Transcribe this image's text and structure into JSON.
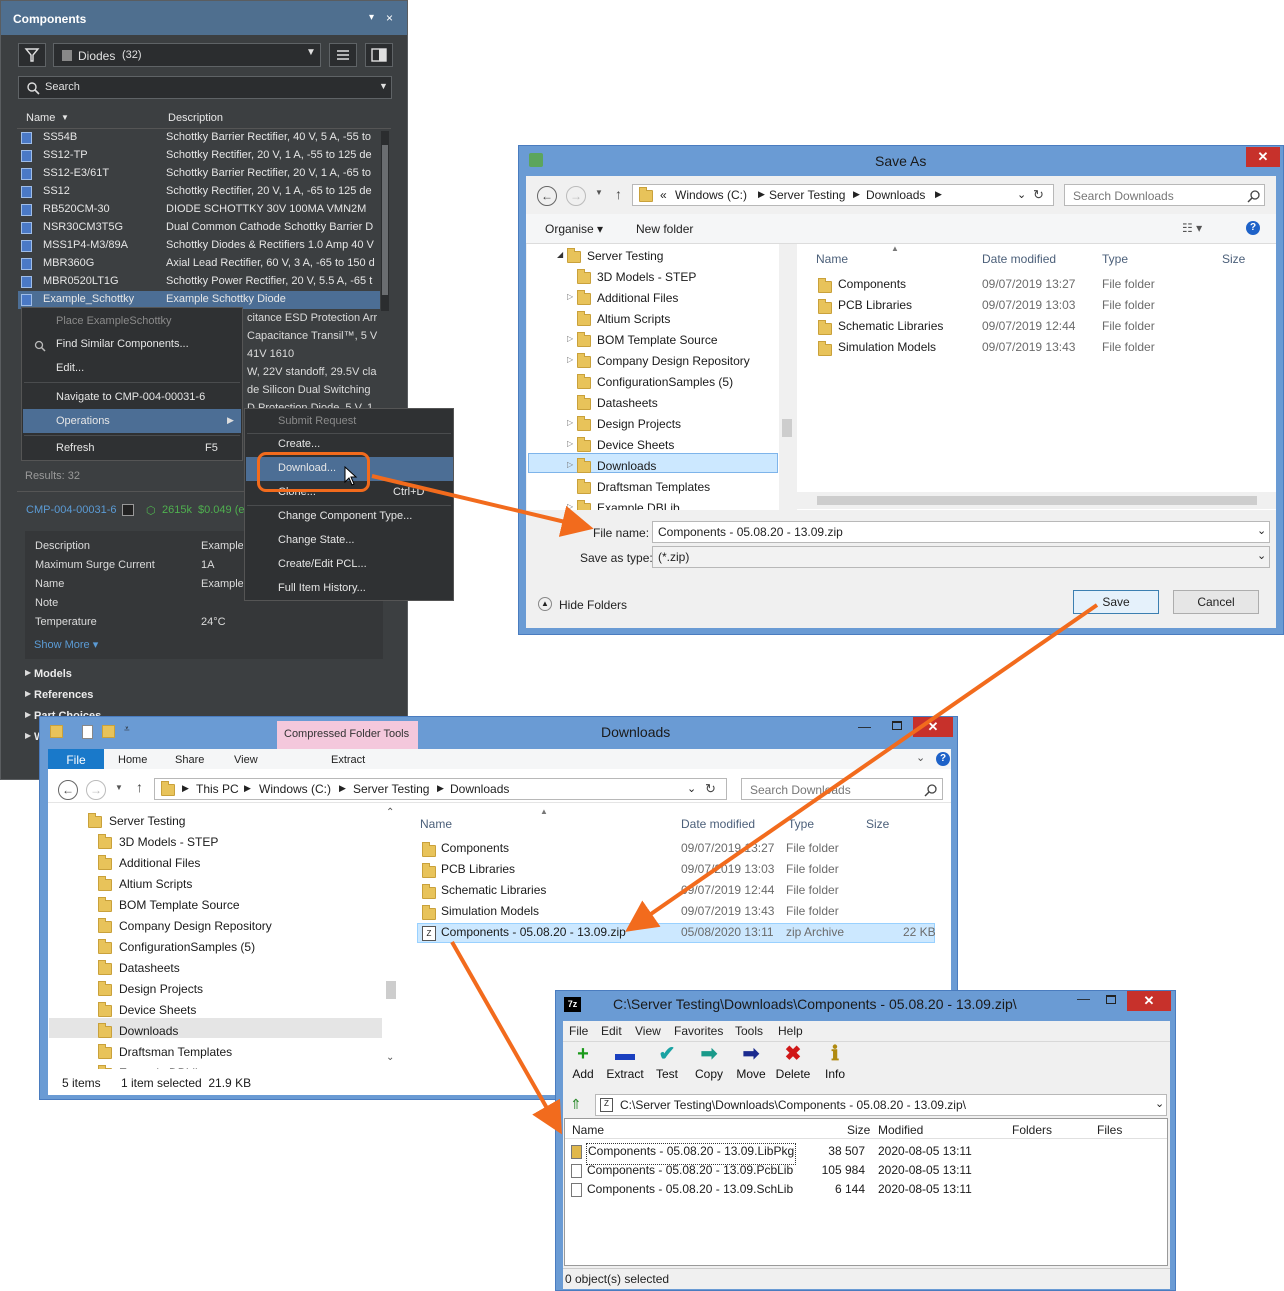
{
  "components_panel": {
    "title": "Components",
    "pin_glyph": "▾",
    "close_glyph": "×",
    "category": "Diodes",
    "count": "(32)",
    "search_placeholder": "Search",
    "columns": {
      "name": "Name",
      "description": "Description"
    },
    "rows": [
      {
        "name": "SS54B",
        "desc": "Schottky Barrier Rectifier, 40 V, 5 A, -55 to"
      },
      {
        "name": "SS12-TP",
        "desc": "Schottky Rectifier, 20 V, 1 A, -55 to 125 de"
      },
      {
        "name": "SS12-E3/61T",
        "desc": "Schottky Barrier Rectifier, 20 V, 1 A, -65 to"
      },
      {
        "name": "SS12",
        "desc": "Schottky Rectifier, 20 V, 1 A, -65 to 125 de"
      },
      {
        "name": "RB520CM-30",
        "desc": "DIODE SCHOTTKY 30V 100MA VMN2M"
      },
      {
        "name": "NSR30CM3T5G",
        "desc": "Dual Common Cathode Schottky Barrier D"
      },
      {
        "name": "MSS1P4-M3/89A",
        "desc": "Schottky Diodes & Rectifiers 1.0 Amp 40 V"
      },
      {
        "name": "MBR360G",
        "desc": "Axial Lead Rectifier, 60 V, 3 A, -65 to 150 d"
      },
      {
        "name": "MBR0520LT1G",
        "desc": "Schottky Power Rectifier, 20 V, 5.5 A, -65 t"
      },
      {
        "name": "Example_Schottky",
        "desc": "Example Schottky Diode"
      }
    ],
    "partial_rows": [
      "citance ESD Protection Arr",
      "Capacitance Transil™, 5 V",
      "41V 1610",
      "W, 22V standoff, 29.5V cla",
      "de Silicon Dual Switching",
      "D Protection Diode, 5 V, 1"
    ],
    "results": "Results: 32",
    "selected_id": "CMP-004-00031-6",
    "stock": "2615k",
    "price": "$0.049 (e",
    "properties": [
      {
        "label": "Description",
        "value": "Example"
      },
      {
        "label": "Maximum Surge Current",
        "value": "1A"
      },
      {
        "label": "Name",
        "value": "Example"
      },
      {
        "label": "Note",
        "value": ""
      },
      {
        "label": "Temperature",
        "value": "24°C"
      }
    ],
    "show_more": "Show More ▾",
    "sections": [
      "Models",
      "References",
      "Part Choices",
      "W"
    ]
  },
  "context_menu": {
    "place": "Place ExampleSchottky",
    "find_similar": "Find Similar Components...",
    "edit": "Edit...",
    "navigate": "Navigate to CMP-004-00031-6",
    "operations": "Operations",
    "refresh": "Refresh",
    "refresh_key": "F5"
  },
  "operations_menu": {
    "submit": "Submit Request",
    "create": "Create...",
    "download": "Download...",
    "clone": "Clone...",
    "clone_key": "Ctrl+D",
    "change_type": "Change Component Type...",
    "change_state": "Change State...",
    "pcl": "Create/Edit PCL...",
    "history": "Full Item History..."
  },
  "save_as": {
    "title": "Save As",
    "crumbs": [
      "«",
      "Windows (C:)",
      "Server Testing",
      "Downloads"
    ],
    "search_placeholder": "Search Downloads",
    "organise": "Organise ▾",
    "new_folder": "New folder",
    "tree": [
      "Server Testing",
      "3D Models - STEP",
      "Additional Files",
      "Altium Scripts",
      "BOM Template Source",
      "Company Design Repository",
      "ConfigurationSamples (5)",
      "Datasheets",
      "Design Projects",
      "Device Sheets",
      "Downloads",
      "Draftsman Templates",
      "Example DBLib"
    ],
    "columns": {
      "name": "Name",
      "date": "Date modified",
      "type": "Type",
      "size": "Size"
    },
    "files": [
      {
        "name": "Components",
        "date": "09/07/2019 13:27",
        "type": "File folder"
      },
      {
        "name": "PCB Libraries",
        "date": "09/07/2019 13:03",
        "type": "File folder"
      },
      {
        "name": "Schematic Libraries",
        "date": "09/07/2019 12:44",
        "type": "File folder"
      },
      {
        "name": "Simulation Models",
        "date": "09/07/2019 13:43",
        "type": "File folder"
      }
    ],
    "file_name_label": "File name:",
    "file_name": "Components - 05.08.20 - 13.09.zip",
    "save_type_label": "Save as type:",
    "save_type": "(*.zip)",
    "hide_folders": "Hide Folders",
    "save": "Save",
    "cancel": "Cancel"
  },
  "explorer": {
    "title": "Downloads",
    "context_tab": "Compressed Folder Tools",
    "ribbon": [
      "File",
      "Home",
      "Share",
      "View"
    ],
    "extract": "Extract",
    "crumbs": [
      "This PC",
      "Windows (C:)",
      "Server Testing",
      "Downloads"
    ],
    "search_placeholder": "Search Downloads",
    "tree": [
      "Server Testing",
      "3D Models - STEP",
      "Additional Files",
      "Altium Scripts",
      "BOM Template Source",
      "Company Design Repository",
      "ConfigurationSamples (5)",
      "Datasheets",
      "Design Projects",
      "Device Sheets",
      "Downloads",
      "Draftsman Templates",
      "Example DBLib"
    ],
    "columns": {
      "name": "Name",
      "date": "Date modified",
      "type": "Type",
      "size": "Size"
    },
    "files": [
      {
        "name": "Components",
        "date": "09/07/2019 13:27",
        "type": "File folder",
        "size": ""
      },
      {
        "name": "PCB Libraries",
        "date": "09/07/2019 13:03",
        "type": "File folder",
        "size": ""
      },
      {
        "name": "Schematic Libraries",
        "date": "09/07/2019 12:44",
        "type": "File folder",
        "size": ""
      },
      {
        "name": "Simulation Models",
        "date": "09/07/2019 13:43",
        "type": "File folder",
        "size": ""
      },
      {
        "name": "Components - 05.08.20 - 13.09.zip",
        "date": "05/08/2020 13:11",
        "type": "zip Archive",
        "size": "22 KB"
      }
    ],
    "status_items": "5 items",
    "status_selected": "1 item selected  21.9 KB"
  },
  "sevenzip": {
    "title": "C:\\Server Testing\\Downloads\\Components - 05.08.20 - 13.09.zip\\",
    "app_icon": "7z",
    "menu": [
      "File",
      "Edit",
      "View",
      "Favorites",
      "Tools",
      "Help"
    ],
    "toolbar": [
      {
        "label": "Add",
        "icon": "+",
        "color": "#1a9a1a"
      },
      {
        "label": "Extract",
        "icon": "▬",
        "color": "#1a3fbf"
      },
      {
        "label": "Test",
        "icon": "✔",
        "color": "#19a3a3"
      },
      {
        "label": "Copy",
        "icon": "➡",
        "color": "#199a8a"
      },
      {
        "label": "Move",
        "icon": "➡",
        "color": "#1a2a8f"
      },
      {
        "label": "Delete",
        "icon": "✖",
        "color": "#d01818"
      },
      {
        "label": "Info",
        "icon": "ℹ",
        "color": "#b08a10"
      }
    ],
    "path": "C:\\Server Testing\\Downloads\\Components - 05.08.20 - 13.09.zip\\",
    "columns": {
      "name": "Name",
      "size": "Size",
      "modified": "Modified",
      "folders": "Folders",
      "files": "Files"
    },
    "files": [
      {
        "name": "Components - 05.08.20 - 13.09.LibPkg",
        "size": "38 507",
        "modified": "2020-08-05 13:11"
      },
      {
        "name": "Components - 05.08.20 - 13.09.PcbLib",
        "size": "105 984",
        "modified": "2020-08-05 13:11"
      },
      {
        "name": "Components - 05.08.20 - 13.09.SchLib",
        "size": "6 144",
        "modified": "2020-08-05 13:11"
      }
    ],
    "status": "0 object(s) selected"
  },
  "accent_color": "#f26b1d"
}
